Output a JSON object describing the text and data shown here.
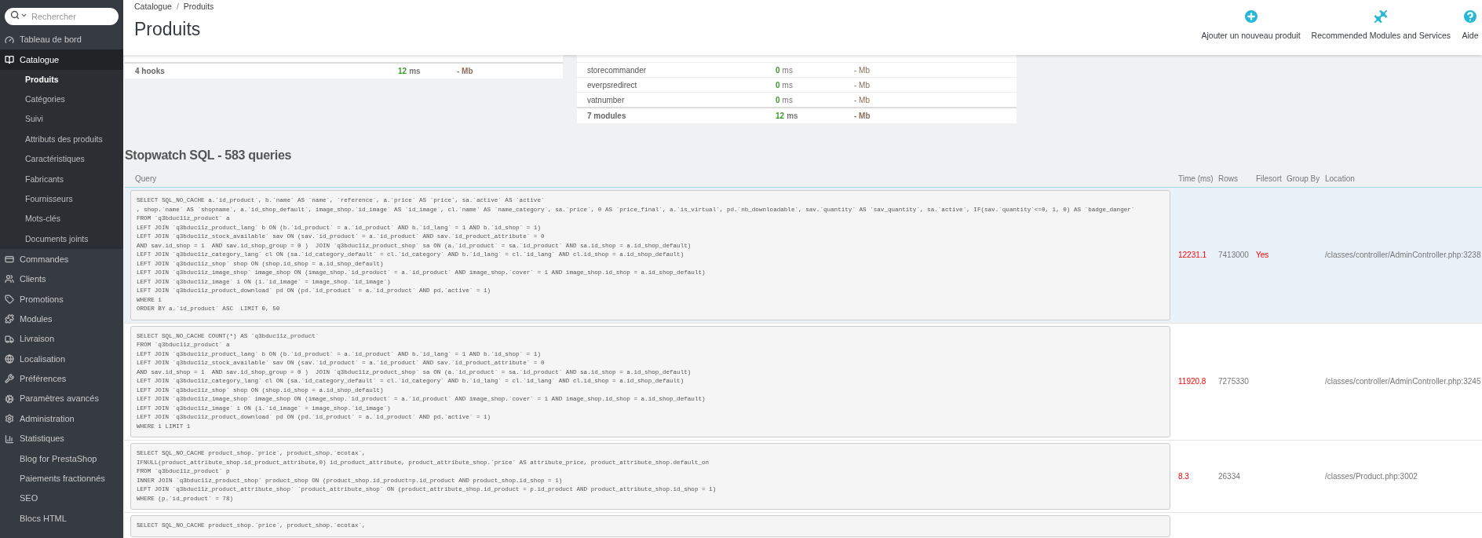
{
  "search": {
    "placeholder": "Rechercher"
  },
  "sidebar": {
    "items": [
      {
        "label": "Tableau de bord",
        "selected": false
      },
      {
        "label": "Catalogue",
        "selected": true,
        "expanded": true,
        "children": [
          {
            "label": "Produits",
            "selected": true
          },
          {
            "label": "Catégories",
            "selected": false
          },
          {
            "label": "Suivi",
            "selected": false
          },
          {
            "label": "Attributs des produits",
            "selected": false
          },
          {
            "label": "Caractéristiques",
            "selected": false
          },
          {
            "label": "Fabricants",
            "selected": false
          },
          {
            "label": "Fournisseurs",
            "selected": false
          },
          {
            "label": "Mots-clés",
            "selected": false
          },
          {
            "label": "Documents joints",
            "selected": false
          }
        ]
      },
      {
        "label": "Commandes",
        "selected": false
      },
      {
        "label": "Clients",
        "selected": false
      },
      {
        "label": "Promotions",
        "selected": false
      },
      {
        "label": "Modules",
        "selected": false
      },
      {
        "label": "Livraison",
        "selected": false
      },
      {
        "label": "Localisation",
        "selected": false
      },
      {
        "label": "Préférences",
        "selected": false
      },
      {
        "label": "Paramètres avancés",
        "selected": false
      },
      {
        "label": "Administration",
        "selected": false
      },
      {
        "label": "Statistiques",
        "selected": false
      },
      {
        "label": "Blog for PrestaShop",
        "selected": false
      },
      {
        "label": "Paiements fractionnés",
        "selected": false
      },
      {
        "label": "SEO",
        "selected": false
      },
      {
        "label": "Blocs HTML",
        "selected": false
      }
    ]
  },
  "breadcrumb": {
    "items": [
      "Catalogue",
      "Produits"
    ],
    "separator": "/"
  },
  "page_title": "Produits",
  "toolbar": [
    {
      "label": "Ajouter un nouveau produit"
    },
    {
      "label": "Recommended Modules and Services"
    },
    {
      "label": "Aide"
    }
  ],
  "hooks_panel": {
    "total": {
      "name": "4 hooks",
      "time": "12",
      "unit": "ms",
      "memory": "- Mb"
    }
  },
  "modules_panel": {
    "rows": [
      {
        "name": "storecommander",
        "time": "0",
        "unit": "ms",
        "memory": "- Mb"
      },
      {
        "name": "everpsredirect",
        "time": "0",
        "unit": "ms",
        "memory": "- Mb"
      },
      {
        "name": "vatnumber",
        "time": "0",
        "unit": "ms",
        "memory": "- Mb"
      }
    ],
    "total": {
      "name": "7 modules",
      "time": "12",
      "unit": "ms",
      "memory": "- Mb"
    }
  },
  "sql": {
    "title": "Stopwatch SQL - 583 queries",
    "columns": [
      "Query",
      "Time (ms)",
      "Rows",
      "Filesort",
      "Group By",
      "Location"
    ],
    "rows": [
      {
        "highlighted": true,
        "query": "SELECT SQL_NO_CACHE a.`id_product`, b.`name` AS `name`, `reference`, a.`price` AS `price`, sa.`active` AS `active`\n, shop.`name` AS `shopname`, a.`id_shop_default`, image_shop.`id_image` AS `id_image`, cl.`name` AS `name_category`, sa.`price`, 0 AS `price_final`, a.`is_virtual`, pd.`nb_downloadable`, sav.`quantity` AS `sav_quantity`, sa.`active`, IF(sav.`quantity`<=0, 1, 0) AS `badge_danger`\nFROM `q3bduc11z_product` a\nLEFT JOIN `q3bduc11z_product_lang` b ON (b.`id_product` = a.`id_product` AND b.`id_lang` = 1 AND b.`id_shop` = 1)\nLEFT JOIN `q3bduc11z_stock_available` sav ON (sav.`id_product` = a.`id_product` AND sav.`id_product_attribute` = 0\nAND sav.id_shop = 1  AND sav.id_shop_group = 0 )  JOIN `q3bduc11z_product_shop` sa ON (a.`id_product` = sa.`id_product` AND sa.id_shop = a.id_shop_default)\nLEFT JOIN `q3bduc11z_category_lang` cl ON (sa.`id_category_default` = cl.`id_category` AND b.`id_lang` = cl.`id_lang` AND cl.id_shop = a.id_shop_default)\nLEFT JOIN `q3bduc11z_shop` shop ON (shop.id_shop = a.id_shop_default)\nLEFT JOIN `q3bduc11z_image_shop` image_shop ON (image_shop.`id_product` = a.`id_product` AND image_shop.`cover` = 1 AND image_shop.id_shop = a.id_shop_default)\nLEFT JOIN `q3bduc11z_image` i ON (i.`id_image` = image_shop.`id_image`)\nLEFT JOIN `q3bduc11z_product_download` pd ON (pd.`id_product` = a.`id_product` AND pd.`active` = 1)\nWHERE 1\nORDER BY a.`id_product` ASC  LIMIT 0, 50",
        "time": "12231.1",
        "rows": "7413000",
        "filesort": "Yes",
        "location": "/classes/controller/AdminController.php:3238"
      },
      {
        "highlighted": false,
        "query": "SELECT SQL_NO_CACHE COUNT(*) AS `q3bduc11z_product`\nFROM `q3bduc11z_product` a\nLEFT JOIN `q3bduc11z_product_lang` b ON (b.`id_product` = a.`id_product` AND b.`id_lang` = 1 AND b.`id_shop` = 1)\nLEFT JOIN `q3bduc11z_stock_available` sav ON (sav.`id_product` = a.`id_product` AND sav.`id_product_attribute` = 0\nAND sav.id_shop = 1  AND sav.id_shop_group = 0 )  JOIN `q3bduc11z_product_shop` sa ON (a.`id_product` = sa.`id_product` AND sa.id_shop = a.id_shop_default)\nLEFT JOIN `q3bduc11z_category_lang` cl ON (sa.`id_category_default` = cl.`id_category` AND b.`id_lang` = cl.`id_lang` AND cl.id_shop = a.id_shop_default)\nLEFT JOIN `q3bduc11z_shop` shop ON (shop.id_shop = a.id_shop_default)\nLEFT JOIN `q3bduc11z_image_shop` image_shop ON (image_shop.`id_product` = a.`id_product` AND image_shop.`cover` = 1 AND image_shop.id_shop = a.id_shop_default)\nLEFT JOIN `q3bduc11z_image` i ON (i.`id_image` = image_shop.`id_image`)\nLEFT JOIN `q3bduc11z_product_download` pd ON (pd.`id_product` = a.`id_product` AND pd.`active` = 1)\nWHERE 1 LIMIT 1",
        "time": "11920.8",
        "rows": "7275330",
        "location": "/classes/controller/AdminController.php:3245"
      },
      {
        "highlighted": false,
        "query": "SELECT SQL_NO_CACHE product_shop.`price`, product_shop.`ecotax`,\nIFNULL(product_attribute_shop.id_product_attribute,0) id_product_attribute, product_attribute_shop.`price` AS attribute_price, product_attribute_shop.default_on\nFROM `q3bduc11z_product` p\nINNER JOIN `q3bduc11z_product_shop` product_shop ON (product_shop.id_product=p.id_product AND product_shop.id_shop = 1)\nLEFT JOIN `q3bduc11z_product_attribute_shop` `product_attribute_shop` ON (product_attribute_shop.id_product = p.id_product AND product_attribute_shop.id_shop = 1)\nWHERE (p.`id_product` = 78)",
        "time": "8.3",
        "rows": "26334",
        "location": "/classes/Product.php:3002"
      },
      {
        "highlighted": false,
        "query": "SELECT SQL_NO_CACHE product_shop.`price`, product_shop.`ecotax`,"
      }
    ]
  }
}
